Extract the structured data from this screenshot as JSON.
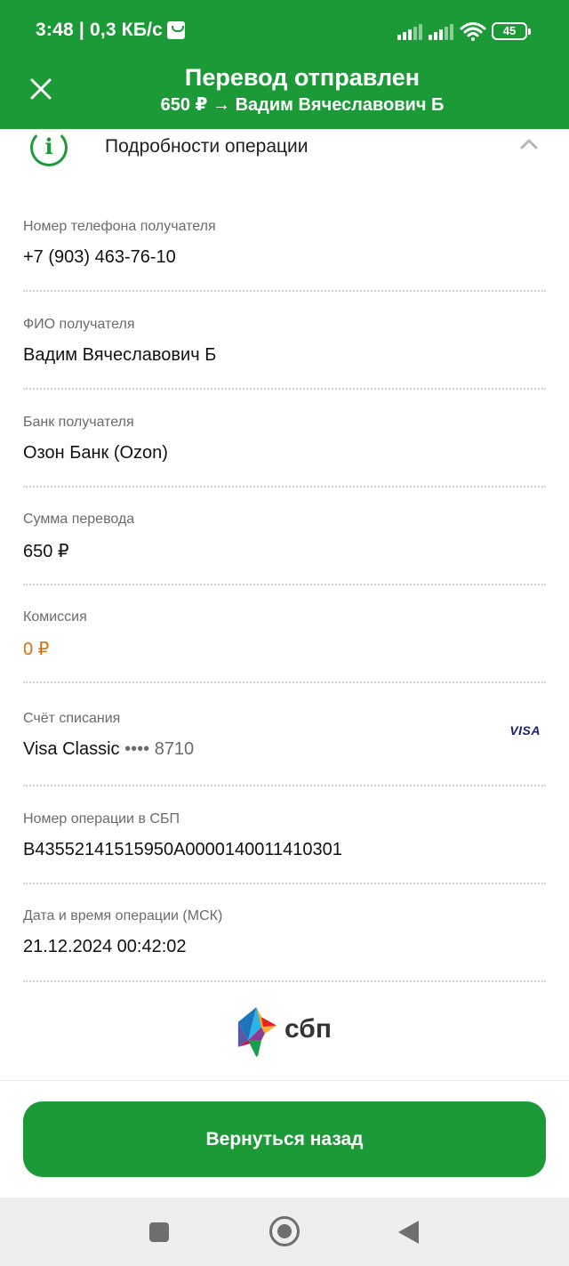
{
  "status_bar": {
    "time_speed": "3:48 | 0,3 КБ/с",
    "battery": "45",
    "icons": [
      "shop-notification-icon",
      "signal-icon",
      "signal-icon",
      "wifi-icon",
      "battery-icon"
    ]
  },
  "header": {
    "title": "Перевод отправлен",
    "subtitle": "650 ₽ → Вадим Вячеславович Б",
    "close_icon": "close-icon",
    "background": "#1c9a37"
  },
  "section": {
    "title": "Подробности операции",
    "info_icon": "i",
    "expanded": true
  },
  "details": [
    {
      "label": "Номер телефона получателя",
      "value": "+7 (903) 463-76-10"
    },
    {
      "label": "ФИО получателя",
      "value": "Вадим Вячеславович Б"
    },
    {
      "label": "Банк получателя",
      "value": "Озон Банк (Ozon)"
    },
    {
      "label": "Сумма перевода",
      "value": "650 ₽"
    },
    {
      "label": "Комиссия",
      "value": "0 ₽",
      "color": "#d6700f"
    },
    {
      "label": "Счёт списания",
      "value": "Visa Classic",
      "card_mask": "•••• 8710",
      "card_brand": "VISA"
    },
    {
      "label": "Номер операции в СБП",
      "value": "B43552141515950A0000140011410301"
    },
    {
      "label": "Дата и время операции (МСК)",
      "value": "21.12.2024 00:42:02"
    }
  ],
  "sbp_logo_text": "сбп",
  "back_button": "Вернуться назад",
  "accent_color": "#1c9a37"
}
